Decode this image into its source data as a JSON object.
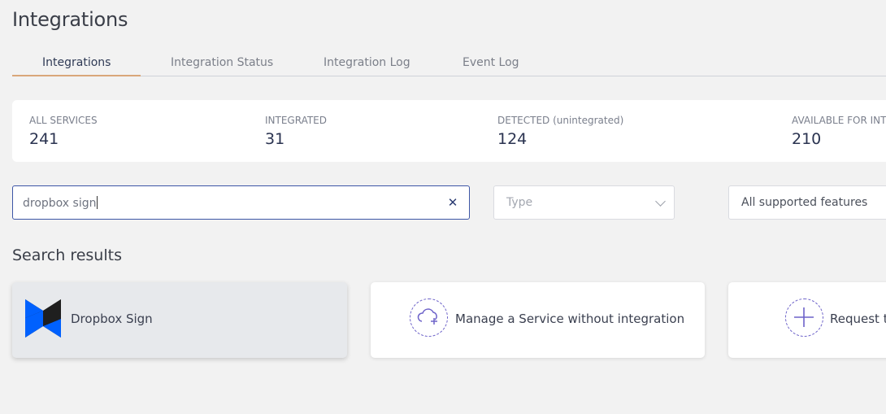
{
  "page": {
    "title": "Integrations"
  },
  "tabs": [
    {
      "label": "Integrations",
      "active": true
    },
    {
      "label": "Integration Status",
      "active": false
    },
    {
      "label": "Integration Log",
      "active": false
    },
    {
      "label": "Event Log",
      "active": false
    }
  ],
  "stats": [
    {
      "label": "ALL SERVICES",
      "value": "241"
    },
    {
      "label": "INTEGRATED",
      "value": "31"
    },
    {
      "label": "DETECTED (unintegrated)",
      "value": "124"
    },
    {
      "label": "AVAILABLE FOR INT",
      "value": "210"
    }
  ],
  "search": {
    "value": "dropbox sign",
    "clear_icon": "close-icon"
  },
  "filters": {
    "type_placeholder": "Type",
    "features_value": "All supported features"
  },
  "results": {
    "title": "Search results",
    "cards": [
      {
        "label": "Dropbox Sign",
        "icon": "dropbox-sign-logo"
      },
      {
        "label": "Manage a Service without integration",
        "icon": "cloud-plus-icon"
      },
      {
        "label": "Request t",
        "icon": "plus-icon"
      }
    ]
  },
  "colors": {
    "accent": "#3d56a6",
    "tab_underline": "#d9a77a",
    "icon_purple": "#6d62c9",
    "dropbox_blue": "#0061fe"
  }
}
